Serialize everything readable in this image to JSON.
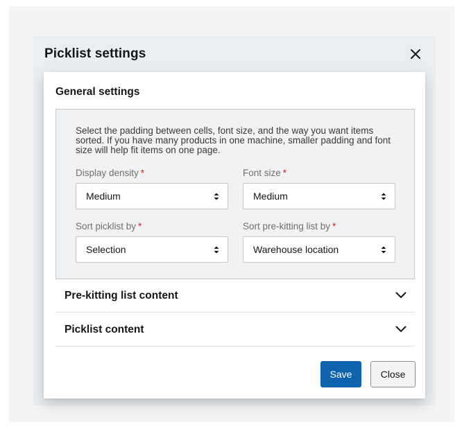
{
  "modal": {
    "title": "Picklist settings",
    "close_icon": "close-icon"
  },
  "general": {
    "heading": "General settings",
    "description": "Select the padding between cells, font size, and the way you want items sorted. If you have many products in one machine, smaller padding and font size will help fit items on one page.",
    "fields": [
      {
        "label": "Display density",
        "value": "Medium",
        "required": "*"
      },
      {
        "label": "Font size",
        "value": "Medium",
        "required": "*"
      },
      {
        "label": "Sort picklist by",
        "value": "Selection",
        "required": "*"
      },
      {
        "label": "Sort pre-kitting list by",
        "value": "Warehouse location",
        "required": "*"
      }
    ]
  },
  "accordions": [
    {
      "title": "Pre-kitting list content",
      "icon": "chevron-down-icon"
    },
    {
      "title": "Picklist content",
      "icon": "chevron-down-icon"
    }
  ],
  "actions": {
    "save_label": "Save",
    "close_label": "Close"
  },
  "colors": {
    "primary": "#0f62ae",
    "required": "#da1e28",
    "panel_bg": "#f0f2f4",
    "shell_bg": "#e8eef2"
  }
}
